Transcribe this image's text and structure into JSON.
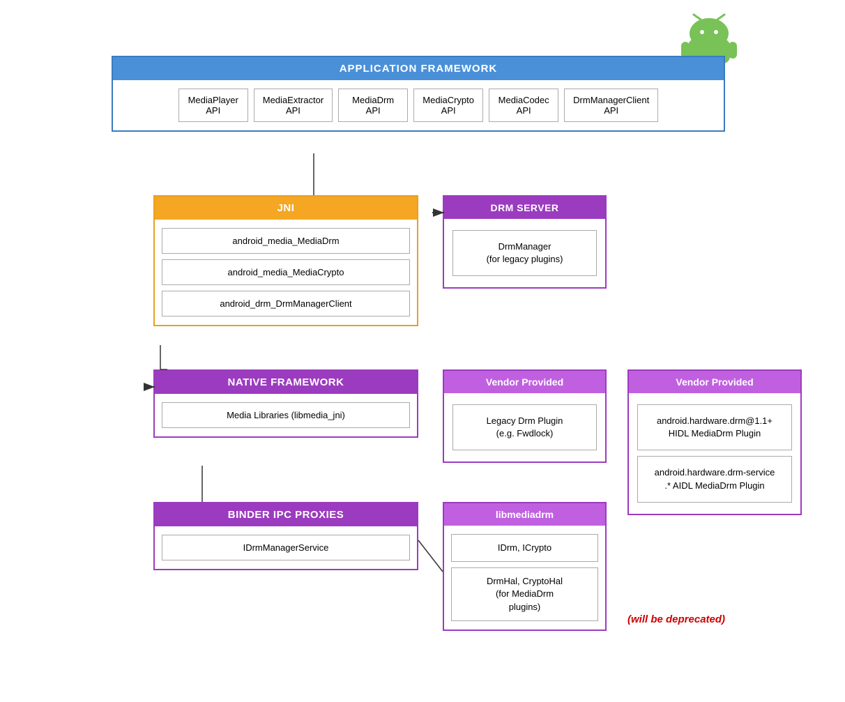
{
  "android_logo": {
    "alt": "Android Logo"
  },
  "app_framework": {
    "header": "APPLICATION FRAMEWORK",
    "apis": [
      {
        "name": "MediaPlayer\nAPI"
      },
      {
        "name": "MediaExtractor\nAPI"
      },
      {
        "name": "MediaDrm\nAPI"
      },
      {
        "name": "MediaCrypto\nAPI"
      },
      {
        "name": "MediaCodec\nAPI"
      },
      {
        "name": "DrmManagerClient\nAPI"
      }
    ]
  },
  "jni": {
    "header": "JNI",
    "items": [
      "android_media_MediaDrm",
      "android_media_MediaCrypto",
      "android_drm_DrmManagerClient"
    ]
  },
  "drm_server": {
    "header": "DRM SERVER",
    "items": [
      "DrmManager\n(for legacy plugins)"
    ]
  },
  "native_framework": {
    "header": "NATIVE FRAMEWORK",
    "items": [
      "Media Libraries (libmedia_jni)"
    ]
  },
  "vendor_left": {
    "header": "Vendor Provided",
    "items": [
      "Legacy Drm Plugin\n(e.g. Fwdlock)"
    ]
  },
  "vendor_right": {
    "header": "Vendor Provided",
    "items": [
      "android.hardware.drm@1.1+\nHIDL MediaDrm Plugin",
      "android.hardware.drm-service\n.* AIDL MediaDrm Plugin"
    ]
  },
  "binder": {
    "header": "BINDER IPC PROXIES",
    "items": [
      "IDrmManagerService"
    ]
  },
  "libmediadrm": {
    "header": "libmediadrm",
    "items": [
      "IDrm, ICrypto",
      "DrmHal, CryptoHal\n(for MediaDrm\nplugins)"
    ]
  },
  "deprecated": "(will be deprecated)"
}
